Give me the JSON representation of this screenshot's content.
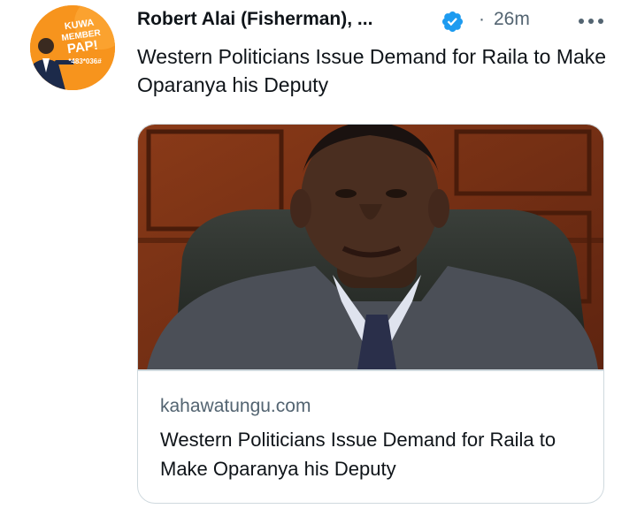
{
  "tweet": {
    "author": "Robert Alai (Fisherman), ...",
    "separator": "·",
    "time": "26m",
    "text": "Western Politicians Issue Demand for Raila to Make Oparanya his Deputy"
  },
  "avatar": {
    "lines": [
      "KUWA",
      "MEMBER",
      "PAP!"
    ],
    "code": "*483*036#",
    "bg_color": "#f7941d"
  },
  "card": {
    "domain": "kahawatungu.com",
    "title": "Western Politicians Issue Demand for Raila to Make Oparanya his Deputy"
  },
  "icons": {
    "verified": "verified-badge-icon",
    "more": "more-options-icon"
  },
  "colors": {
    "verified_blue": "#1d9bf0",
    "secondary_text": "#536471",
    "border": "#cfd9de"
  }
}
